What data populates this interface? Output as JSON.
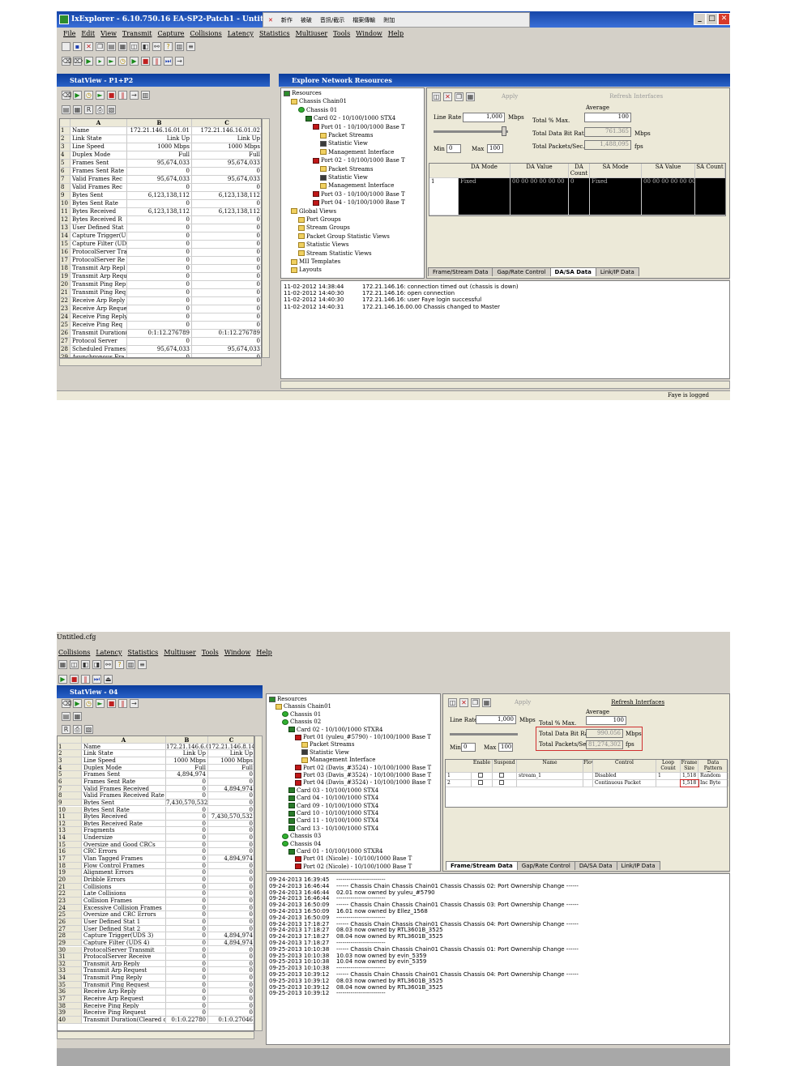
{
  "shot1": {
    "title": "IxExplorer - 6.10.750.16 EA-SP2-Patch1 - Untitled.cfg",
    "ime_items": [
      "新作",
      "被破",
      "音訊/截示",
      "檔案傳輸",
      "附加"
    ],
    "menu": [
      "File",
      "Edit",
      "View",
      "Transmit",
      "Capture",
      "Collisions",
      "Latency",
      "Statistics",
      "Multiuser",
      "Tools",
      "Window",
      "Help"
    ],
    "statview_title": "StatView - P1+P2",
    "grid_headers": [
      "A",
      "B",
      "C"
    ],
    "grid_rows": [
      [
        "1",
        "Name",
        "172.21.146.16.01.01",
        "172.21.146.16.01.02"
      ],
      [
        "2",
        "Link State",
        "Link Up",
        "Link Up"
      ],
      [
        "3",
        "Line Speed",
        "1000 Mbps",
        "1000 Mbps"
      ],
      [
        "4",
        "Duplex Mode",
        "Full",
        "Full"
      ],
      [
        "5",
        "Frames Sent",
        "95,674,033",
        "95,674,033"
      ],
      [
        "6",
        "Frames Sent Rate",
        "0",
        "0"
      ],
      [
        "7",
        "Valid Frames Rec",
        "95,674,033",
        "95,674,033"
      ],
      [
        "8",
        "Valid Frames Rec",
        "0",
        "0"
      ],
      [
        "9",
        "Bytes Sent",
        "6,123,138,112",
        "6,123,138,112"
      ],
      [
        "10",
        "Bytes Sent Rate",
        "0",
        "0"
      ],
      [
        "11",
        "Bytes Received",
        "6,123,138,112",
        "6,123,138,112"
      ],
      [
        "12",
        "Bytes Received R",
        "0",
        "0"
      ],
      [
        "13",
        "User Defined Stat",
        "0",
        "0"
      ],
      [
        "14",
        "Capture Trigger(U",
        "0",
        "0"
      ],
      [
        "15",
        "Capture Filter (UD",
        "0",
        "0"
      ],
      [
        "16",
        "ProtocolServer Tra",
        "0",
        "0"
      ],
      [
        "17",
        "ProtocolServer Re",
        "0",
        "0"
      ],
      [
        "18",
        "Transmit Arp Repl",
        "0",
        "0"
      ],
      [
        "19",
        "Transmit Arp Requ",
        "0",
        "0"
      ],
      [
        "20",
        "Transmit Ping Rep",
        "0",
        "0"
      ],
      [
        "21",
        "Transmit Ping Req",
        "0",
        "0"
      ],
      [
        "22",
        "Receive Arp Reply",
        "0",
        "0"
      ],
      [
        "23",
        "Receive Arp Reque",
        "0",
        "0"
      ],
      [
        "24",
        "Receive Ping Reply",
        "0",
        "0"
      ],
      [
        "25",
        "Receive Ping Req",
        "0",
        "0"
      ],
      [
        "26",
        "Transmit Duration(",
        "0:1:12.276789",
        "0:1:12.276789"
      ],
      [
        "27",
        "Protocol Server",
        "0",
        "0"
      ],
      [
        "28",
        "Scheduled Frames",
        "95,674,033",
        "95,674,033"
      ],
      [
        "29",
        "Asynchronous Fra",
        "0",
        "0"
      ]
    ],
    "explore_title": "Explore Network Resources",
    "tree": [
      {
        "d": 0,
        "i": "res",
        "t": "Resources"
      },
      {
        "d": 1,
        "i": "fold",
        "t": "Chassis Chain01"
      },
      {
        "d": 2,
        "i": "chs",
        "t": "Chassis 01"
      },
      {
        "d": 3,
        "i": "card",
        "t": "Card 02 - 10/100/1000 STX4"
      },
      {
        "d": 4,
        "i": "port",
        "t": "Port 01 - 10/100/1000 Base T"
      },
      {
        "d": 5,
        "i": "fold",
        "t": "Packet Streams"
      },
      {
        "d": 5,
        "i": "strm",
        "t": "Statistic View"
      },
      {
        "d": 5,
        "i": "fold",
        "t": "Management Interface"
      },
      {
        "d": 4,
        "i": "port",
        "t": "Port 02 - 10/100/1000 Base T"
      },
      {
        "d": 5,
        "i": "fold",
        "t": "Packet Streams"
      },
      {
        "d": 5,
        "i": "strm",
        "t": "Statistic View"
      },
      {
        "d": 5,
        "i": "fold",
        "t": "Management Interface"
      },
      {
        "d": 4,
        "i": "port",
        "t": "Port 03 - 10/100/1000 Base T"
      },
      {
        "d": 4,
        "i": "port",
        "t": "Port 04 - 10/100/1000 Base T"
      },
      {
        "d": 1,
        "i": "fold",
        "t": "Global Views"
      },
      {
        "d": 2,
        "i": "fold",
        "t": "Port Groups"
      },
      {
        "d": 2,
        "i": "fold",
        "t": "Stream Groups"
      },
      {
        "d": 2,
        "i": "fold",
        "t": "Packet Group Statistic Views"
      },
      {
        "d": 2,
        "i": "fold",
        "t": "Statistic Views"
      },
      {
        "d": 2,
        "i": "fold",
        "t": "Stream Statistic Views"
      },
      {
        "d": 1,
        "i": "fold",
        "t": "MII Templates"
      },
      {
        "d": 1,
        "i": "fold",
        "t": "Layouts"
      }
    ],
    "rp_apply": "Apply",
    "rp_refresh": "Refresh Interfaces",
    "line_rate_label": "Line Rate",
    "line_rate_val": "1,000",
    "mbps": "Mbps",
    "average": "Average",
    "total_pct_max": "Total % Max.",
    "total_pct_val": "100",
    "total_bit_rate": "Total Data Bit Rate",
    "total_bit_val": "761.365",
    "mbps2": "Mbps",
    "total_pkts": "Total Packets/Sec.",
    "total_pkts_val": "1,488,095",
    "fps": "fps",
    "min_label": "Min",
    "min_val": "0",
    "max_label": "Max",
    "max_val": "100",
    "da_headers": [
      "DA Mode",
      "DA Value",
      "DA Count",
      "SA Mode",
      "SA Value",
      "SA Count"
    ],
    "da_row": [
      "1",
      "Fixed",
      "00 00 00 00 00 00",
      "0",
      "Fixed",
      "00 00 00 00 00 00"
    ],
    "tabs": [
      "Frame/Stream Data",
      "Gap/Rate Control",
      "DA/SA Data",
      "Link/IP Data"
    ],
    "log": [
      [
        "11-02-2012 14:38:44",
        "172.21.146.16: connection timed out (chassis is down)"
      ],
      [
        "11-02-2012 14:40:30",
        "172.21.146.16: open connection"
      ],
      [
        "11-02-2012 14:40:30",
        "172.21.146.16: user Faye login successful"
      ],
      [
        "11-02-2012 14:40:31",
        "172.21.146.16.00.00 Chassis changed to Master"
      ]
    ],
    "status": "Faye is logged"
  },
  "shot2": {
    "title": "Untitled.cfg",
    "menu": [
      "Collisions",
      "Latency",
      "Statistics",
      "Multiuser",
      "Tools",
      "Window",
      "Help"
    ],
    "statview_title": "StatView - 04",
    "grid_headers": [
      "A",
      "B",
      "C"
    ],
    "grid_rows": [
      [
        "1",
        "Name",
        "172.21.146.6.02.01",
        "172.21.146.8.14.04"
      ],
      [
        "2",
        "Link State",
        "Link Up",
        "Link Up"
      ],
      [
        "3",
        "Line Speed",
        "1000 Mbps",
        "1000 Mbps"
      ],
      [
        "4",
        "Duplex Mode",
        "Full",
        "Full"
      ],
      [
        "5",
        "Frames Sent",
        "4,894,974",
        "0"
      ],
      [
        "6",
        "Frames Sent Rate",
        "0",
        "0"
      ],
      [
        "7",
        "Valid Frames Received",
        "0",
        "4,894,974"
      ],
      [
        "8",
        "Valid Frames Received Rate",
        "0",
        "0"
      ],
      [
        "9",
        "Bytes Sent",
        "7,430,570,532",
        "0"
      ],
      [
        "10",
        "Bytes Sent Rate",
        "0",
        "0"
      ],
      [
        "11",
        "Bytes Received",
        "0",
        "7,430,570,532"
      ],
      [
        "12",
        "Bytes Received Rate",
        "0",
        "0"
      ],
      [
        "13",
        "Fragments",
        "0",
        "0"
      ],
      [
        "14",
        "Undersize",
        "0",
        "0"
      ],
      [
        "15",
        "Oversize and Good CRCs",
        "0",
        "0"
      ],
      [
        "16",
        "CRC Errors",
        "0",
        "0"
      ],
      [
        "17",
        "Vlan Tagged Frames",
        "0",
        "4,894,974"
      ],
      [
        "18",
        "Flow Control Frames",
        "0",
        "0"
      ],
      [
        "19",
        "Alignment Errors",
        "0",
        "0"
      ],
      [
        "20",
        "Dribble Errors",
        "0",
        "0"
      ],
      [
        "21",
        "Collisions",
        "0",
        "0"
      ],
      [
        "22",
        "Late Collisions",
        "0",
        "0"
      ],
      [
        "23",
        "Collision Frames",
        "0",
        "0"
      ],
      [
        "24",
        "Excessive Collision Frames",
        "0",
        "0"
      ],
      [
        "25",
        "Oversize and CRC Errors",
        "0",
        "0"
      ],
      [
        "26",
        "User Defined Stat 1",
        "0",
        "0"
      ],
      [
        "27",
        "User Defined Stat 2",
        "0",
        "0"
      ],
      [
        "28",
        "Capture Trigger(UDS 3)",
        "0",
        "4,894,974"
      ],
      [
        "29",
        "Capture Filter (UDS 4)",
        "0",
        "4,894,974"
      ],
      [
        "30",
        "ProtocolServer Transmit",
        "0",
        "0"
      ],
      [
        "31",
        "ProtocolServer Receive",
        "0",
        "0"
      ],
      [
        "32",
        "Transmit Arp Reply",
        "0",
        "0"
      ],
      [
        "33",
        "Transmit Arp Request",
        "0",
        "0"
      ],
      [
        "34",
        "Transmit Ping Reply",
        "0",
        "0"
      ],
      [
        "35",
        "Transmit Ping Request",
        "0",
        "0"
      ],
      [
        "36",
        "Receive Arp Reply",
        "0",
        "0"
      ],
      [
        "37",
        "Receive Arp Request",
        "0",
        "0"
      ],
      [
        "38",
        "Receive Ping Reply",
        "0",
        "0"
      ],
      [
        "39",
        "Receive Ping Request",
        "0",
        "0"
      ],
      [
        "40",
        "Transmit Duration(Cleared on Start Tx)",
        "0:1:0.22780",
        "0:1:0.27046"
      ]
    ],
    "explore_title": "Explore Network Resources",
    "tree": [
      {
        "d": 0,
        "i": "res",
        "t": "Resources"
      },
      {
        "d": 1,
        "i": "fold",
        "t": "Chassis Chain01"
      },
      {
        "d": 2,
        "i": "chs",
        "t": "Chassis 01"
      },
      {
        "d": 2,
        "i": "chs",
        "t": "Chassis 02"
      },
      {
        "d": 3,
        "i": "card",
        "t": "Card 02 - 10/100/1000 STXR4"
      },
      {
        "d": 4,
        "i": "port",
        "t": "Port 01 (yuleu_#5790) - 10/100/1000 Base T"
      },
      {
        "d": 5,
        "i": "fold",
        "t": "Packet Streams"
      },
      {
        "d": 5,
        "i": "strm",
        "t": "Statistic View"
      },
      {
        "d": 5,
        "i": "fold",
        "t": "Management Interface"
      },
      {
        "d": 4,
        "i": "port",
        "t": "Port 02 (Davis_#3524) - 10/100/1000 Base T"
      },
      {
        "d": 4,
        "i": "port",
        "t": "Port 03 (Davis_#3524) - 10/100/1000 Base T"
      },
      {
        "d": 4,
        "i": "port",
        "t": "Port 04 (Davis_#3524) - 10/100/1000 Base T"
      },
      {
        "d": 3,
        "i": "card",
        "t": "Card 03 - 10/100/1000 STX4"
      },
      {
        "d": 3,
        "i": "card",
        "t": "Card 04 - 10/100/1000 STX4"
      },
      {
        "d": 3,
        "i": "card",
        "t": "Card 09 - 10/100/1000 STX4"
      },
      {
        "d": 3,
        "i": "card",
        "t": "Card 10 - 10/100/1000 STX4"
      },
      {
        "d": 3,
        "i": "card",
        "t": "Card 11 - 10/100/1000 STX4"
      },
      {
        "d": 3,
        "i": "card",
        "t": "Card 13 - 10/100/1000 STX4"
      },
      {
        "d": 2,
        "i": "chs",
        "t": "Chassis 03"
      },
      {
        "d": 2,
        "i": "chs",
        "t": "Chassis 04"
      },
      {
        "d": 3,
        "i": "card",
        "t": "Card 01 - 10/100/1000 STXR4"
      },
      {
        "d": 4,
        "i": "port",
        "t": "Port 01 (Nicole) - 10/100/1000 Base T"
      },
      {
        "d": 4,
        "i": "port",
        "t": "Port 02 (Nicole) - 10/100/1000 Base T"
      }
    ],
    "rp_apply": "Apply",
    "rp_refresh": "Refresh Interfaces",
    "line_rate_label": "Line Rate",
    "line_rate_val": "1,000",
    "mbps": "Mbps",
    "average": "Average",
    "total_pct_max": "Total % Max.",
    "total_pct_val": "100",
    "total_bit_rate": "Total Data Bit Rate",
    "total_bit_val": "990.056",
    "mbps2": "Mbps",
    "total_pkts": "Total Packets/Sec.",
    "total_pkts_val": "81,274,302",
    "fps": "fps",
    "min_label": "Min",
    "min_val": "0",
    "max_label": "Max",
    "max_val": "100",
    "stream_headers": [
      "Enable",
      "Suspend",
      "Name",
      "Flow",
      "Control",
      "Loop Count",
      "Frame Size",
      "Data Pattern Type"
    ],
    "stream_rows": [
      [
        "1",
        "",
        "",
        "stream_1",
        "",
        "Disabled",
        "1",
        "1,518",
        "Random"
      ],
      [
        "2",
        "",
        "",
        "",
        "",
        "Continuous Packet",
        "",
        "1,518",
        "Inc Byte"
      ]
    ],
    "tabs": [
      "Frame/Stream Data",
      "Gap/Rate Control",
      "DA/SA Data",
      "Link/IP Data"
    ],
    "log": [
      [
        "09-24-2013 16:39:45",
        "------------------------"
      ],
      [
        "09-24-2013 16:46:44",
        "------  Chassis Chain Chassis Chain01 Chassis Chassis 02: Port Ownership Change  ------"
      ],
      [
        "09-24-2013 16:46:44",
        "02.01 now owned by yuleu_#5790"
      ],
      [
        "09-24-2013 16:46:44",
        "------------------------"
      ],
      [
        "09-24-2013 16:50:09",
        "------  Chassis Chain Chassis Chain01 Chassis Chassis 03: Port Ownership Change  ------"
      ],
      [
        "09-24-2013 16:50:09",
        "16.01 now owned by Ellez_1568"
      ],
      [
        "09-24-2013 16:50:09",
        "------------------------"
      ],
      [
        "09-24-2013 17:18:27",
        "------  Chassis Chain Chassis Chain01 Chassis Chassis 04: Port Ownership Change  ------"
      ],
      [
        "09-24-2013 17:18:27",
        "08.03 now owned by RTL3601B_3525"
      ],
      [
        "09-24-2013 17:18:27",
        "08.04 now owned by RTL3601B_3525"
      ],
      [
        "09-24-2013 17:18:27",
        "------------------------"
      ],
      [
        "09-25-2013 10:10:38",
        "------  Chassis Chain Chassis Chain01 Chassis Chassis 01: Port Ownership Change  ------"
      ],
      [
        "09-25-2013 10:10:38",
        "10.03 now owned by evin_5359"
      ],
      [
        "09-25-2013 10:10:38",
        "10.04 now owned by evin_5359"
      ],
      [
        "09-25-2013 10:10:38",
        "------------------------"
      ],
      [
        "09-25-2013 10:39:12",
        "------  Chassis Chain Chassis Chain01 Chassis Chassis 04: Port Ownership Change  ------"
      ],
      [
        "09-25-2013 10:39:12",
        "08.03 now owned by RTL3601B_3525"
      ],
      [
        "09-25-2013 10:39:12",
        "08.04 now owned by RTL3601B_3525"
      ],
      [
        "09-25-2013 10:39:12",
        "------------------------"
      ]
    ]
  }
}
